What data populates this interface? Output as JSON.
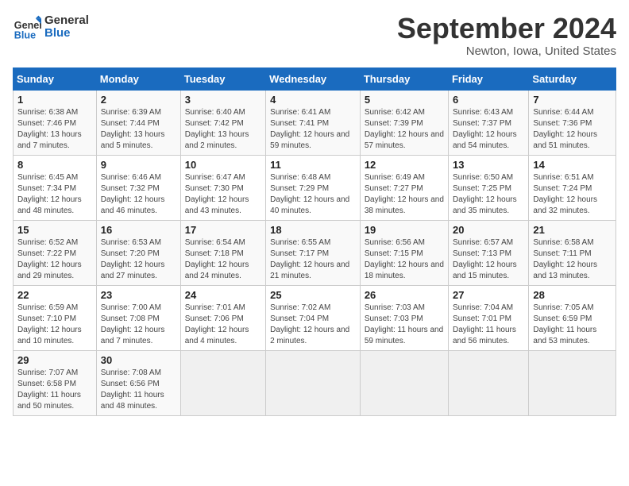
{
  "header": {
    "logo_general": "General",
    "logo_blue": "Blue",
    "title": "September 2024",
    "location": "Newton, Iowa, United States"
  },
  "days_of_week": [
    "Sunday",
    "Monday",
    "Tuesday",
    "Wednesday",
    "Thursday",
    "Friday",
    "Saturday"
  ],
  "weeks": [
    [
      {
        "day": "1",
        "sunrise": "Sunrise: 6:38 AM",
        "sunset": "Sunset: 7:46 PM",
        "daylight": "Daylight: 13 hours and 7 minutes."
      },
      {
        "day": "2",
        "sunrise": "Sunrise: 6:39 AM",
        "sunset": "Sunset: 7:44 PM",
        "daylight": "Daylight: 13 hours and 5 minutes."
      },
      {
        "day": "3",
        "sunrise": "Sunrise: 6:40 AM",
        "sunset": "Sunset: 7:42 PM",
        "daylight": "Daylight: 13 hours and 2 minutes."
      },
      {
        "day": "4",
        "sunrise": "Sunrise: 6:41 AM",
        "sunset": "Sunset: 7:41 PM",
        "daylight": "Daylight: 12 hours and 59 minutes."
      },
      {
        "day": "5",
        "sunrise": "Sunrise: 6:42 AM",
        "sunset": "Sunset: 7:39 PM",
        "daylight": "Daylight: 12 hours and 57 minutes."
      },
      {
        "day": "6",
        "sunrise": "Sunrise: 6:43 AM",
        "sunset": "Sunset: 7:37 PM",
        "daylight": "Daylight: 12 hours and 54 minutes."
      },
      {
        "day": "7",
        "sunrise": "Sunrise: 6:44 AM",
        "sunset": "Sunset: 7:36 PM",
        "daylight": "Daylight: 12 hours and 51 minutes."
      }
    ],
    [
      {
        "day": "8",
        "sunrise": "Sunrise: 6:45 AM",
        "sunset": "Sunset: 7:34 PM",
        "daylight": "Daylight: 12 hours and 48 minutes."
      },
      {
        "day": "9",
        "sunrise": "Sunrise: 6:46 AM",
        "sunset": "Sunset: 7:32 PM",
        "daylight": "Daylight: 12 hours and 46 minutes."
      },
      {
        "day": "10",
        "sunrise": "Sunrise: 6:47 AM",
        "sunset": "Sunset: 7:30 PM",
        "daylight": "Daylight: 12 hours and 43 minutes."
      },
      {
        "day": "11",
        "sunrise": "Sunrise: 6:48 AM",
        "sunset": "Sunset: 7:29 PM",
        "daylight": "Daylight: 12 hours and 40 minutes."
      },
      {
        "day": "12",
        "sunrise": "Sunrise: 6:49 AM",
        "sunset": "Sunset: 7:27 PM",
        "daylight": "Daylight: 12 hours and 38 minutes."
      },
      {
        "day": "13",
        "sunrise": "Sunrise: 6:50 AM",
        "sunset": "Sunset: 7:25 PM",
        "daylight": "Daylight: 12 hours and 35 minutes."
      },
      {
        "day": "14",
        "sunrise": "Sunrise: 6:51 AM",
        "sunset": "Sunset: 7:24 PM",
        "daylight": "Daylight: 12 hours and 32 minutes."
      }
    ],
    [
      {
        "day": "15",
        "sunrise": "Sunrise: 6:52 AM",
        "sunset": "Sunset: 7:22 PM",
        "daylight": "Daylight: 12 hours and 29 minutes."
      },
      {
        "day": "16",
        "sunrise": "Sunrise: 6:53 AM",
        "sunset": "Sunset: 7:20 PM",
        "daylight": "Daylight: 12 hours and 27 minutes."
      },
      {
        "day": "17",
        "sunrise": "Sunrise: 6:54 AM",
        "sunset": "Sunset: 7:18 PM",
        "daylight": "Daylight: 12 hours and 24 minutes."
      },
      {
        "day": "18",
        "sunrise": "Sunrise: 6:55 AM",
        "sunset": "Sunset: 7:17 PM",
        "daylight": "Daylight: 12 hours and 21 minutes."
      },
      {
        "day": "19",
        "sunrise": "Sunrise: 6:56 AM",
        "sunset": "Sunset: 7:15 PM",
        "daylight": "Daylight: 12 hours and 18 minutes."
      },
      {
        "day": "20",
        "sunrise": "Sunrise: 6:57 AM",
        "sunset": "Sunset: 7:13 PM",
        "daylight": "Daylight: 12 hours and 15 minutes."
      },
      {
        "day": "21",
        "sunrise": "Sunrise: 6:58 AM",
        "sunset": "Sunset: 7:11 PM",
        "daylight": "Daylight: 12 hours and 13 minutes."
      }
    ],
    [
      {
        "day": "22",
        "sunrise": "Sunrise: 6:59 AM",
        "sunset": "Sunset: 7:10 PM",
        "daylight": "Daylight: 12 hours and 10 minutes."
      },
      {
        "day": "23",
        "sunrise": "Sunrise: 7:00 AM",
        "sunset": "Sunset: 7:08 PM",
        "daylight": "Daylight: 12 hours and 7 minutes."
      },
      {
        "day": "24",
        "sunrise": "Sunrise: 7:01 AM",
        "sunset": "Sunset: 7:06 PM",
        "daylight": "Daylight: 12 hours and 4 minutes."
      },
      {
        "day": "25",
        "sunrise": "Sunrise: 7:02 AM",
        "sunset": "Sunset: 7:04 PM",
        "daylight": "Daylight: 12 hours and 2 minutes."
      },
      {
        "day": "26",
        "sunrise": "Sunrise: 7:03 AM",
        "sunset": "Sunset: 7:03 PM",
        "daylight": "Daylight: 11 hours and 59 minutes."
      },
      {
        "day": "27",
        "sunrise": "Sunrise: 7:04 AM",
        "sunset": "Sunset: 7:01 PM",
        "daylight": "Daylight: 11 hours and 56 minutes."
      },
      {
        "day": "28",
        "sunrise": "Sunrise: 7:05 AM",
        "sunset": "Sunset: 6:59 PM",
        "daylight": "Daylight: 11 hours and 53 minutes."
      }
    ],
    [
      {
        "day": "29",
        "sunrise": "Sunrise: 7:07 AM",
        "sunset": "Sunset: 6:58 PM",
        "daylight": "Daylight: 11 hours and 50 minutes."
      },
      {
        "day": "30",
        "sunrise": "Sunrise: 7:08 AM",
        "sunset": "Sunset: 6:56 PM",
        "daylight": "Daylight: 11 hours and 48 minutes."
      },
      null,
      null,
      null,
      null,
      null
    ]
  ]
}
